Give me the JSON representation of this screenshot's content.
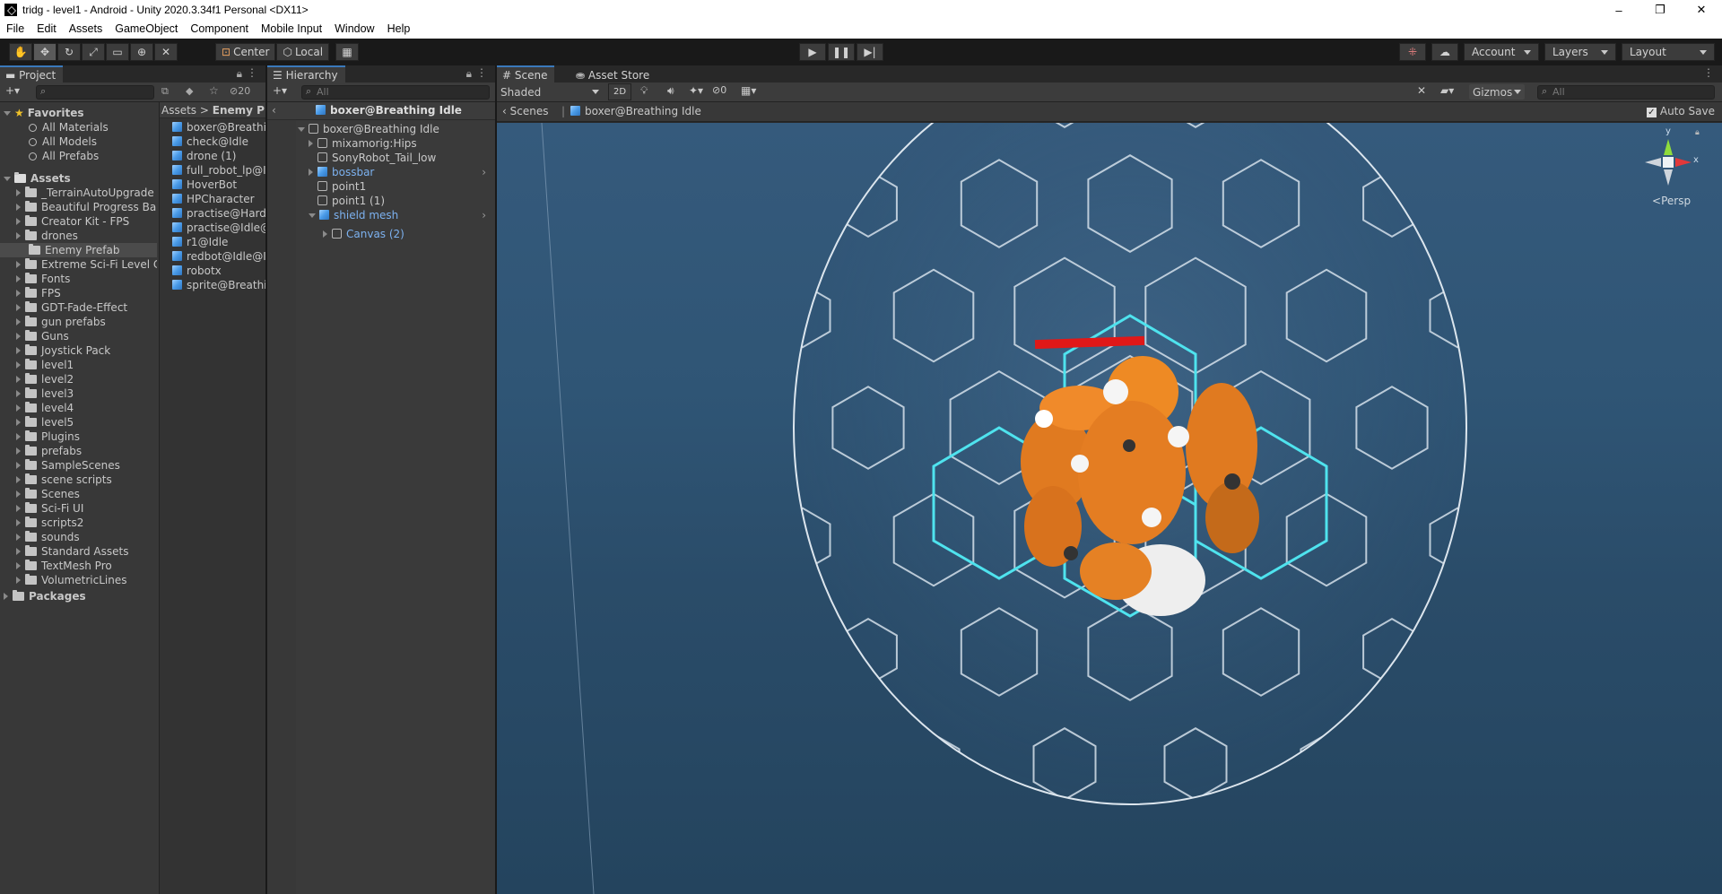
{
  "window": {
    "title": "tridg - level1 - Android - Unity 2020.3.34f1 Personal <DX11>",
    "controls": [
      "–",
      "❐",
      "✕"
    ]
  },
  "menu": [
    "File",
    "Edit",
    "Assets",
    "GameObject",
    "Component",
    "Mobile Input",
    "Window",
    "Help"
  ],
  "toolbar": {
    "tools": [
      "hand-tool",
      "move-tool",
      "rotate-tool",
      "scale-tool",
      "rect-tool",
      "transform-tool",
      "custom-tool"
    ],
    "pivot": "Center",
    "space": "Local",
    "account": "Account",
    "layers": "Layers",
    "layout": "Layout"
  },
  "project": {
    "tab": "Project",
    "hidden_count": "20",
    "favorites_label": "Favorites",
    "favorites": [
      "All Materials",
      "All Models",
      "All Prefabs"
    ],
    "assets_label": "Assets",
    "folders": [
      "_TerrainAutoUpgrade",
      "Beautiful Progress Bar",
      "Creator Kit - FPS",
      "drones",
      "Enemy Prefab",
      "Extreme Sci-Fi Level C",
      "Fonts",
      "FPS",
      "GDT-Fade-Effect",
      "gun prefabs",
      "Guns",
      "Joystick Pack",
      "level1",
      "level2",
      "level3",
      "level4",
      "level5",
      "Plugins",
      "prefabs",
      "SampleScenes",
      "scene scripts",
      "Scenes",
      "Sci-Fi UI",
      "scripts2",
      "sounds",
      "Standard Assets",
      "TextMesh Pro",
      "VolumetricLines"
    ],
    "packages_label": "Packages",
    "breadcrumb": [
      "Assets",
      "Enemy Pre"
    ],
    "files": [
      "boxer@Breathin",
      "check@Idle",
      "drone (1)",
      "full_robot_lp@Id",
      "HoverBot",
      "HPCharacter",
      "practise@Hard",
      "practise@Idle@",
      "r1@Idle",
      "redbot@Idle@Id",
      "robotx",
      "sprite@Breathin"
    ]
  },
  "hierarchy": {
    "tab": "Hierarchy",
    "search_placeholder": "All",
    "prefab_header": "boxer@Breathing Idle",
    "root": "boxer@Breathing Idle",
    "items": [
      {
        "label": "mixamorig:Hips",
        "blue": false,
        "expander": "right"
      },
      {
        "label": "SonyRobot_Tail_low",
        "blue": false,
        "expander": ""
      },
      {
        "label": "bossbar",
        "blue": true,
        "expander": "right"
      },
      {
        "label": "point1",
        "blue": false,
        "expander": ""
      },
      {
        "label": "point1 (1)",
        "blue": false,
        "expander": ""
      },
      {
        "label": "shield mesh",
        "blue": true,
        "expander": "down"
      }
    ],
    "child": "Canvas (2)"
  },
  "scene": {
    "tabs": [
      "Scene",
      "Asset Store"
    ],
    "shading": "Shaded",
    "mode_2d": "2D",
    "hidden_count": "0",
    "gizmos": "Gizmos",
    "search_placeholder": "All",
    "breadcrumb_root": "Scenes",
    "breadcrumb_current": "boxer@Breathing Idle",
    "auto_save": "Auto Save",
    "projection": "Persp",
    "axes": {
      "y": "y",
      "x": "x"
    }
  }
}
